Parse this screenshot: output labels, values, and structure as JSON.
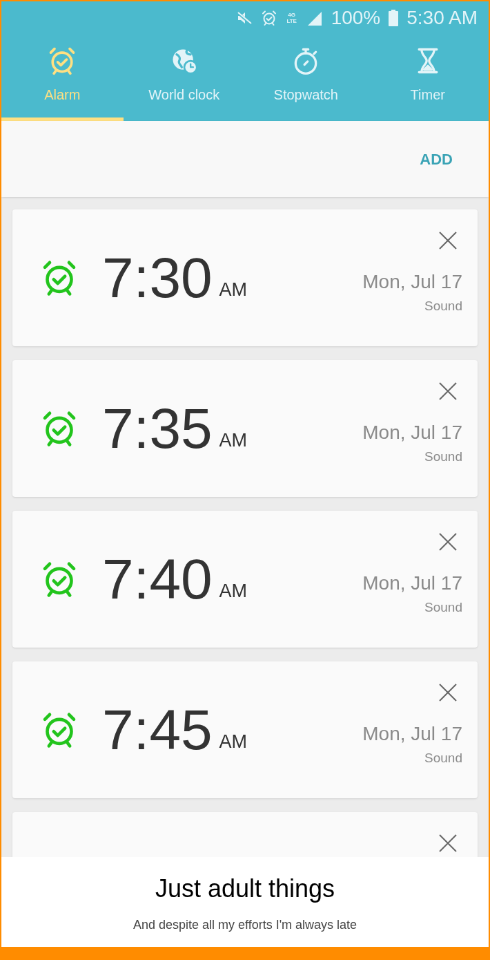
{
  "status_bar": {
    "network": "4G LTE",
    "battery": "100%",
    "time": "5:30 AM"
  },
  "tabs": [
    {
      "label": "Alarm",
      "kind": "alarm",
      "selected": true
    },
    {
      "label": "World clock",
      "kind": "globe",
      "selected": false
    },
    {
      "label": "Stopwatch",
      "kind": "stopwatch",
      "selected": false
    },
    {
      "label": "Timer",
      "kind": "hourglass",
      "selected": false
    }
  ],
  "add_button": "ADD",
  "alarms": [
    {
      "kind": "full",
      "on": true,
      "time": "7:30",
      "ampm": "AM",
      "date": "Mon, Jul 17",
      "type": "Sound"
    },
    {
      "kind": "full",
      "on": true,
      "time": "7:35",
      "ampm": "AM",
      "date": "Mon, Jul 17",
      "type": "Sound"
    },
    {
      "kind": "full",
      "on": true,
      "time": "7:40",
      "ampm": "AM",
      "date": "Mon, Jul 17",
      "type": "Sound"
    },
    {
      "kind": "full",
      "on": true,
      "time": "7:45",
      "ampm": "AM",
      "date": "Mon, Jul 17",
      "type": "Sound"
    },
    {
      "kind": "partial"
    }
  ],
  "caption": {
    "title": "Just adult things",
    "subtitle": "And despite all my efforts I'm always late"
  }
}
